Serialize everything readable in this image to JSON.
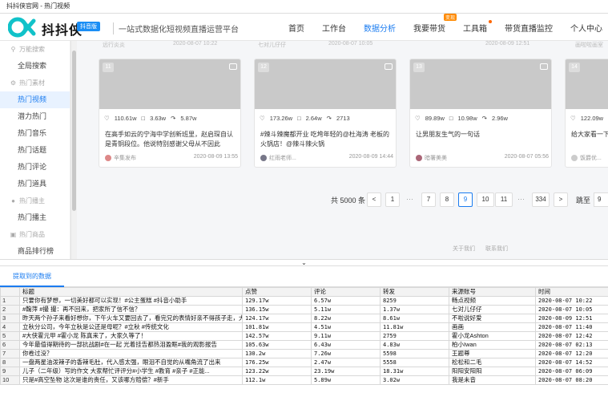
{
  "window": {
    "title": "抖抖侠官网 - 热门视频"
  },
  "header": {
    "logo_text": "抖抖侠",
    "logo_badge": "抖音版",
    "tagline": "一站式数据化短视频直播运营平台",
    "nav": [
      {
        "label": "首页",
        "active": false
      },
      {
        "label": "工作台",
        "active": false
      },
      {
        "label": "数据分析",
        "active": true
      },
      {
        "label": "我要带货",
        "badge": "变现"
      },
      {
        "label": "工具箱",
        "dot": true
      },
      {
        "label": "带货直播监控"
      },
      {
        "label": "个人中心"
      }
    ]
  },
  "sidebar": {
    "items": [
      {
        "type": "group",
        "label": "万能搜索",
        "icon": "search-icon"
      },
      {
        "type": "item",
        "label": "全局搜索"
      },
      {
        "type": "group",
        "label": "热门素材",
        "icon": "material-icon"
      },
      {
        "type": "item",
        "label": "热门视频",
        "active": true
      },
      {
        "type": "item",
        "label": "潜力热门"
      },
      {
        "type": "item",
        "label": "热门音乐"
      },
      {
        "type": "item",
        "label": "热门话题"
      },
      {
        "type": "item",
        "label": "热门评论"
      },
      {
        "type": "item",
        "label": "热门道具"
      },
      {
        "type": "group",
        "label": "热门播主",
        "icon": "user-icon"
      },
      {
        "type": "item",
        "label": "热门播主"
      },
      {
        "type": "group",
        "label": "热门商品",
        "icon": "goods-icon"
      },
      {
        "type": "item",
        "label": "商品排行榜"
      }
    ]
  },
  "cards": [
    {
      "rank": "11",
      "likes": "110.61w",
      "comments": "3.63w",
      "shares": "5.87w",
      "desc": "在高手如云的宁海中学创新班里，赵启琛自认是青铜段位。他说特别感谢父母从不因此",
      "author": "辛集发布",
      "date": "2020-08-09 13:55"
    },
    {
      "rank": "12",
      "likes": "173.26w",
      "comments": "2.64w",
      "shares": "2713",
      "desc": "#辣斗辣魔都开业 吃垮年轻的@杜海涛 老板的火锅店！@辣斗辣火锅",
      "author": "红雨老师...",
      "date": "2020-08-09 14:44"
    },
    {
      "rank": "13",
      "likes": "89.89w",
      "comments": "10.98w",
      "shares": "2.96w",
      "desc": "让男朋友生气的一句话",
      "author": "暗署美美",
      "date": "2020-08-07 05:56"
    },
    {
      "rank": "14",
      "likes": "122.09w",
      "comments": "",
      "shares": "",
      "desc": "给大家看一下",
      "author": "饭爵优...",
      "date": ""
    }
  ],
  "top_meta": [
    {
      "author": "远行炎炎",
      "date": "2020-08-07 10:22"
    },
    {
      "author": "七对儿仔仔",
      "date": "2020-08-07 10:05"
    },
    {
      "author": "",
      "date": "2020-08-09 12:51"
    },
    {
      "author": "画啦啦画室",
      "date": ""
    }
  ],
  "pagination": {
    "total": "共 5000 条",
    "prev": "<",
    "next": ">",
    "pages": [
      "1",
      "7",
      "8",
      "9",
      "10",
      "11",
      "334"
    ],
    "ellipsis": "···",
    "current": "9",
    "jump_label": "跳至",
    "jump_value": "9"
  },
  "footer": {
    "about": "关于我们",
    "contact": "联系我们"
  },
  "splitter": {
    "chevron": "⌄"
  },
  "panel": {
    "tab_label": "提取到的数据"
  },
  "table": {
    "columns": [
      "标题",
      "点赞",
      "评论",
      "转发",
      "来源账号",
      "时间"
    ],
    "rows": [
      [
        "1",
        "只要你有梦想，一切美好都可以实现！#公主蛋糕 #抖音小助手",
        "129.17w",
        "6.57w",
        "8259",
        "畅点视频",
        "2020-08-07 10:22"
      ],
      [
        "2",
        "#鞠萍 #撮 撮：再不回来，把家所了信不信？",
        "136.15w",
        "5.11w",
        "1.37w",
        "七对儿仔仔",
        "2020-08-07 10:05"
      ],
      [
        "3",
        "昨天两个孙子来看好想你，下午火车又要回去了，看完兄的表情好亲不得孩子走，大...",
        "124.17w",
        "8.22w",
        "8.61w",
        "不啦说好爱",
        "2020-08-09 12:51"
      ],
      [
        "4",
        "立秋分公司，今年立秋是公还是母呢？#立秋 #传统文化",
        "101.81w",
        "4.51w",
        "11.81w",
        "画画",
        "2020-08-07 11:40"
      ],
      [
        "5",
        "#大侠霍元甲 #霍小龙 陈真来了，大家久等了！",
        "142.57w",
        "9.11w",
        "2759",
        "霍小龙Ashton",
        "2020-08-07 12:42"
      ],
      [
        "6",
        "今年最值得期待的一部抗战剧#在一起  光着挂告都热泪盈眶#我的观影报告",
        "105.63w",
        "6.43w",
        "4.83w",
        "柏小Iwan",
        "2020-08-07 02:13"
      ],
      [
        "7",
        "你卷过没？",
        "130.2w",
        "7.26w",
        "5598",
        "王题尊",
        "2020-08-07 12:20"
      ],
      [
        "8",
        "一盘两星油泼辣子的香辣毛肚，代入感太强，眼泪不自觉的从嘴角流了出来",
        "176.25w",
        "2.47w",
        "5558",
        "松松和二毛",
        "2020-08-07 14:52"
      ],
      [
        "9",
        "儿子（二年级）写的作文  大家帮忙评评分#小学生 #教育 #亲子 #正能...",
        "123.22w",
        "23.19w",
        "18.31w",
        "阳阳安阳阳",
        "2020-08-07 06:09"
      ],
      [
        "10",
        "只是#高空坠物 这次是谁的责任，又该哪方赔偿？#新手",
        "112.1w",
        "5.89w",
        "3.02w",
        "我是未音",
        "2020-08-07 08:20"
      ]
    ]
  }
}
